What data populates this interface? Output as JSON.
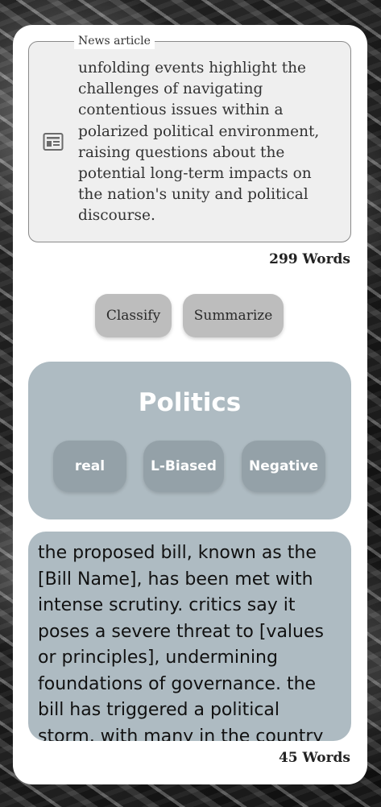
{
  "news": {
    "label": "News article",
    "icon": "newspaper-icon",
    "text": "unfolding events highlight the challenges of navigating contentious issues within a polarized political environment, raising questions about the potential long-term impacts on the nation's unity and political discourse.",
    "word_count_label": "299 Words"
  },
  "actions": {
    "classify_label": "Classify",
    "summarize_label": "Summarize"
  },
  "classification": {
    "category": "Politics",
    "authenticity": "real",
    "bias": "L-Biased",
    "sentiment": "Negative"
  },
  "summary": {
    "text": "the proposed bill, known as the [Bill Name], has been met with intense scrutiny. critics say it poses a severe threat to [values or principles], undermining foundations of governance. the bill has triggered a political storm, with many in the country and",
    "word_count_label": "45 Words"
  },
  "colors": {
    "panel": "#aebbc2",
    "chip": "#94a1a8",
    "button": "#bdbdbd",
    "background_card": "#ffffff"
  }
}
